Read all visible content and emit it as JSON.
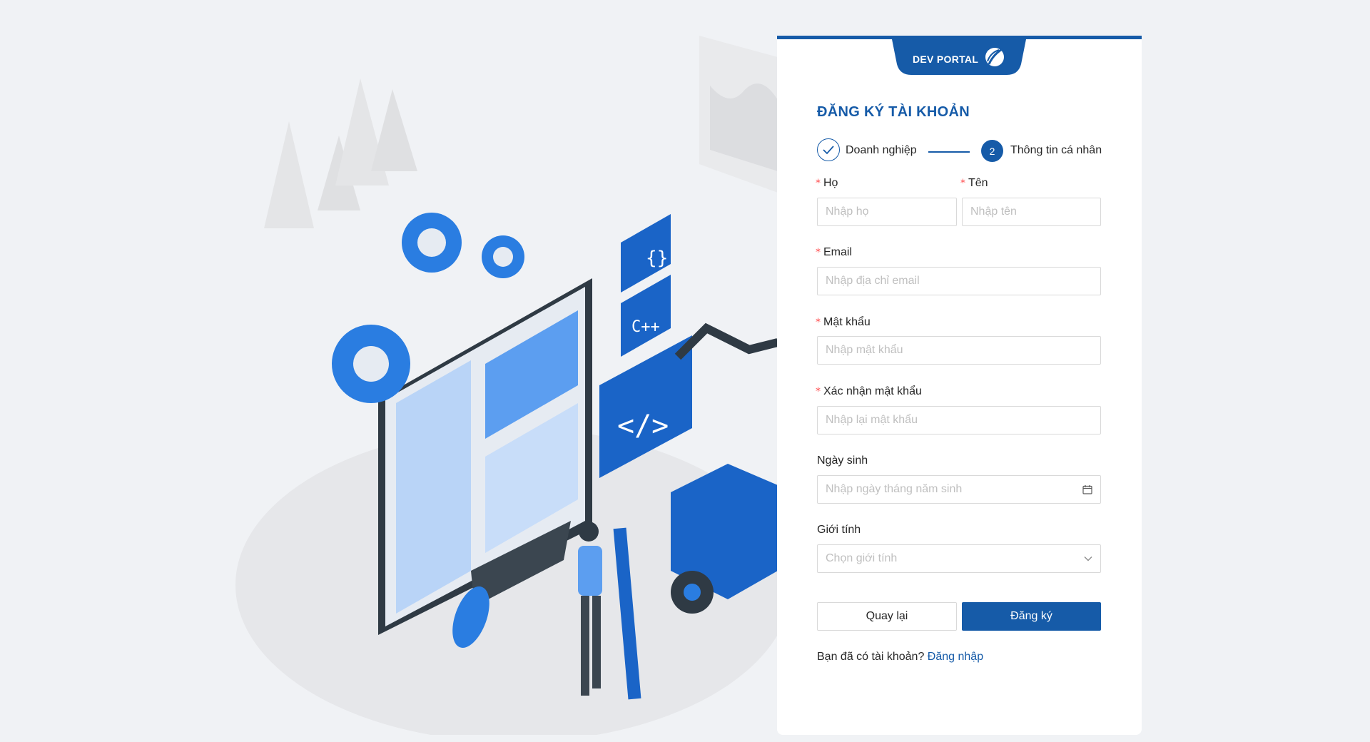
{
  "brand": {
    "name": "DEV PORTAL"
  },
  "form": {
    "title": "ĐĂNG KÝ TÀI KHOẢN",
    "steps": [
      {
        "label": "Doanh nghiệp",
        "status": "done"
      },
      {
        "number": "2",
        "label": "Thông tin cá nhân",
        "status": "active"
      }
    ],
    "fields": {
      "ho": {
        "label": "Họ",
        "required": "*",
        "placeholder": "Nhập họ",
        "value": ""
      },
      "ten": {
        "label": "Tên",
        "required": "*",
        "placeholder": "Nhập tên",
        "value": ""
      },
      "email": {
        "label": "Email",
        "required": "*",
        "placeholder": "Nhập địa chỉ email",
        "value": ""
      },
      "password": {
        "label": "Mật khẩu",
        "required": "*",
        "placeholder": "Nhập mật khẩu",
        "value": ""
      },
      "confirm_password": {
        "label": "Xác nhận mật khẩu",
        "required": "*",
        "placeholder": "Nhập lại mật khẩu",
        "value": ""
      },
      "birthday": {
        "label": "Ngày sinh",
        "placeholder": "Nhập ngày tháng năm sinh",
        "icon": "calendar-icon"
      },
      "gender": {
        "label": "Giới tính",
        "placeholder": "Chọn giới tính",
        "icon": "chevron-down-icon"
      }
    },
    "buttons": {
      "back": "Quay lại",
      "submit": "Đăng ký"
    },
    "login_prompt": {
      "text": "Bạn đã có tài khoản?",
      "link": "Đăng nhập"
    }
  },
  "colors": {
    "primary": "#165ba8",
    "required": "#ff4d4f",
    "background": "#f0f2f5",
    "illustration_blue": "#2a7de1"
  }
}
